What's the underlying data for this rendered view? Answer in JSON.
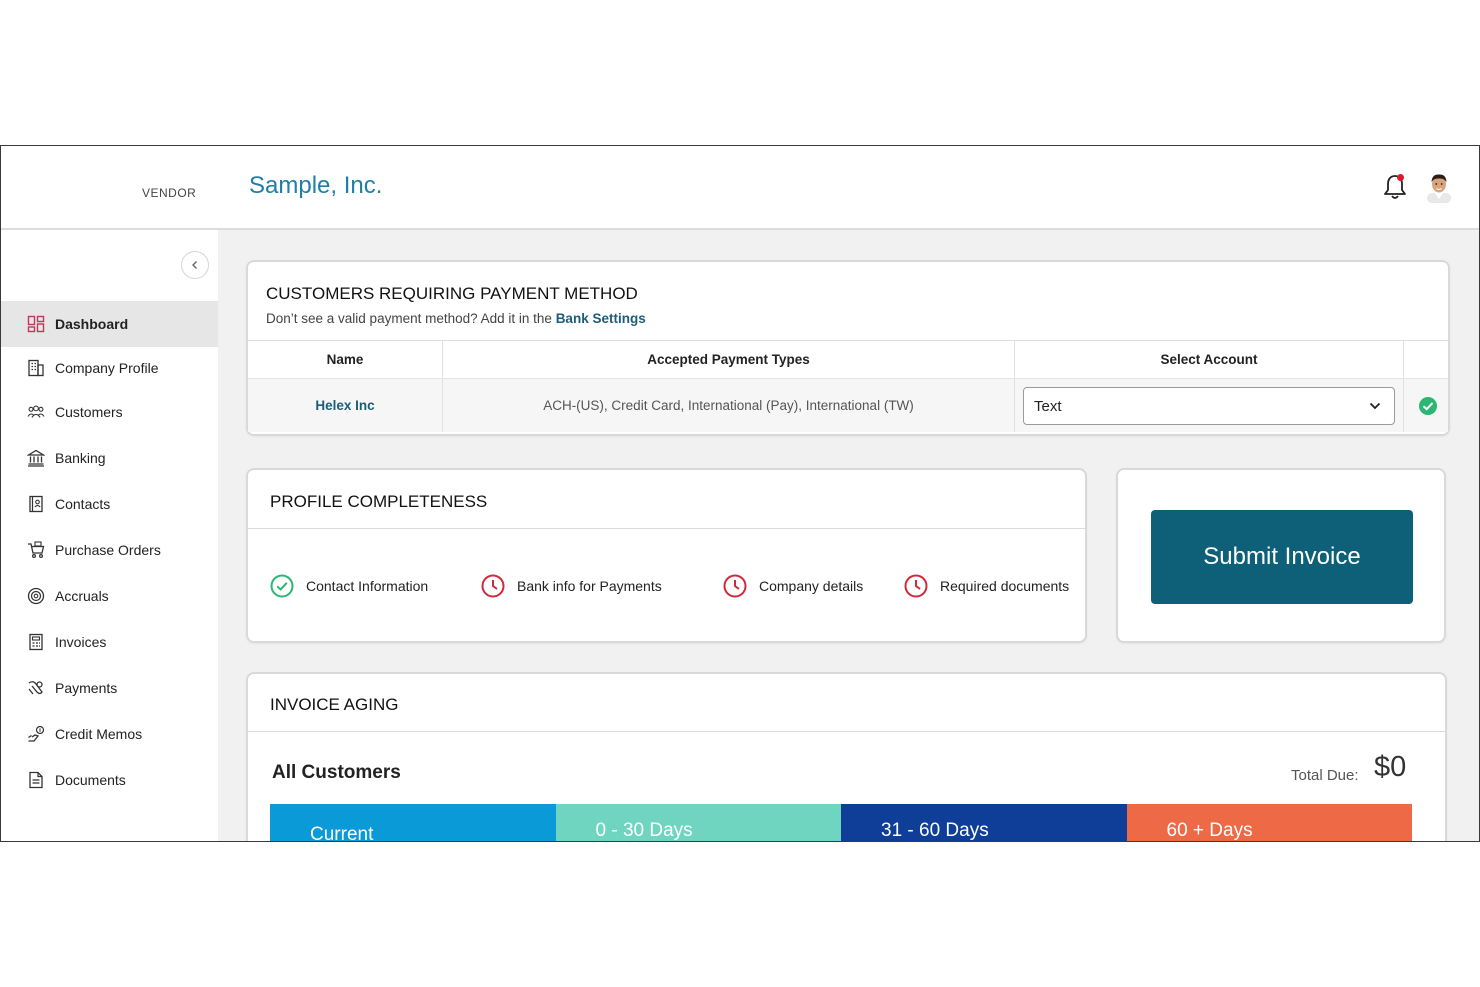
{
  "header": {
    "vendor_label": "VENDOR",
    "app_title": "Sample, Inc."
  },
  "sidebar": {
    "items": [
      {
        "label": "Dashboard",
        "icon": "dashboard-icon",
        "active": true
      },
      {
        "label": "Company Profile",
        "icon": "building-icon"
      },
      {
        "label": "Customers",
        "icon": "users-icon"
      },
      {
        "label": "Banking",
        "icon": "bank-icon"
      },
      {
        "label": "Contacts",
        "icon": "contacts-book-icon"
      },
      {
        "label": "Purchase Orders",
        "icon": "cart-icon"
      },
      {
        "label": "Accruals",
        "icon": "coins-icon"
      },
      {
        "label": "Invoices",
        "icon": "invoice-icon"
      },
      {
        "label": "Payments",
        "icon": "payment-icon"
      },
      {
        "label": "Credit Memos",
        "icon": "credit-memo-icon"
      },
      {
        "label": "Documents",
        "icon": "document-icon"
      }
    ]
  },
  "payment_method": {
    "title": "CUSTOMERS REQUIRING PAYMENT METHOD",
    "subtitle": "Don’t see a valid payment method? Add it in the ",
    "subtitle_link": "Bank Settings",
    "columns": [
      "Name",
      "Accepted Payment Types",
      "Select Account"
    ],
    "rows": [
      {
        "name": "Helex Inc",
        "types": "ACH-(US), Credit Card, International (Pay), International (TW)",
        "account": "Text"
      }
    ]
  },
  "profile": {
    "title": "PROFILE COMPLETENESS",
    "items": [
      {
        "label": "Contact Information",
        "status": "complete"
      },
      {
        "label": "Bank info for Payments",
        "status": "pending"
      },
      {
        "label": "Company details",
        "status": "pending"
      },
      {
        "label": "Required documents",
        "status": "pending"
      }
    ]
  },
  "submit": {
    "label": "Submit Invoice"
  },
  "aging": {
    "title": "INVOICE AGING",
    "subtitle": "All Customers",
    "total_label": "Total Due:",
    "total_value": "$0",
    "segments": [
      {
        "label": "Current",
        "color": "#0a9ad8"
      },
      {
        "label": "0 - 30 Days",
        "color": "#6fd5c0"
      },
      {
        "label": "31 - 60 Days",
        "color": "#0f3e99"
      },
      {
        "label": "60 + Days",
        "color": "#ee6a47"
      }
    ]
  },
  "colors": {
    "accent": "#1f7fa6",
    "button": "#0e6078",
    "success": "#2bb673",
    "pending": "#d0293a"
  }
}
